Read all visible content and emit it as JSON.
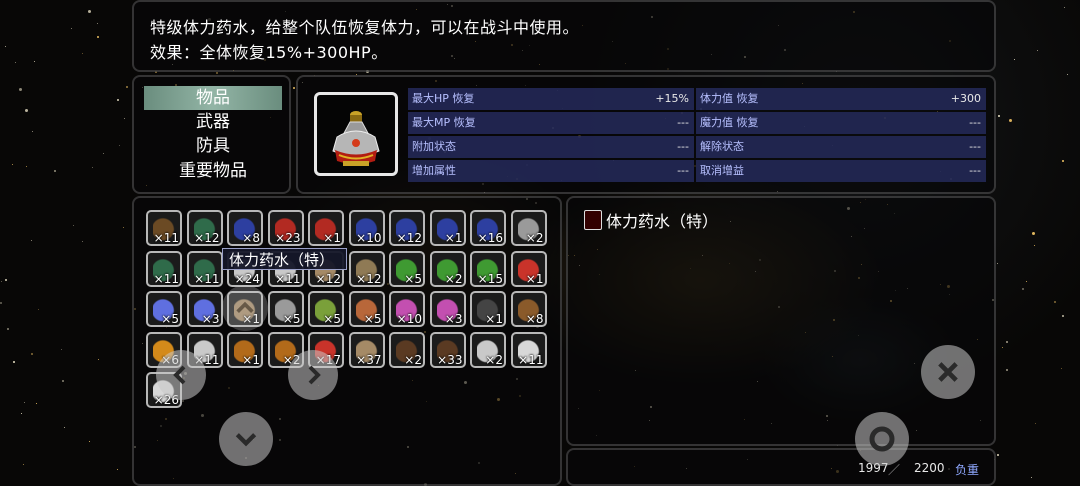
{
  "description": {
    "line1": "特级体力药水，给整个队伍恢复体力，可以在战斗中使用。",
    "line2": "效果：全体恢复15%+300HP。"
  },
  "categories": [
    {
      "label": "物品",
      "selected": true
    },
    {
      "label": "武器",
      "selected": false
    },
    {
      "label": "防具",
      "selected": false
    },
    {
      "label": "重要物品",
      "selected": false
    }
  ],
  "stats": [
    {
      "label": "最大HP 恢复",
      "value": "+15%"
    },
    {
      "label": "体力值 恢复",
      "value": "+300"
    },
    {
      "label": "最大MP 恢复",
      "value": "---"
    },
    {
      "label": "魔力值 恢复",
      "value": "---"
    },
    {
      "label": "附加状态",
      "value": "---"
    },
    {
      "label": "解除状态",
      "value": "---"
    },
    {
      "label": "增加属性",
      "value": "---"
    },
    {
      "label": "取消增益",
      "value": "---"
    }
  ],
  "items": [
    [
      "×11",
      "×12",
      "×8",
      "×23",
      "×1",
      "×10",
      "×12",
      "×1",
      "×16",
      "×2"
    ],
    [
      "×11",
      "×11",
      "×24",
      "×11",
      "×12",
      "×12",
      "×5",
      "×2",
      "×15",
      "×1"
    ],
    [
      "×5",
      "×3",
      "×1",
      "×5",
      "×5",
      "×5",
      "×10",
      "×3",
      "×1",
      "×8"
    ],
    [
      "×6",
      "×11",
      "×1",
      "×2",
      "×17",
      "×37",
      "×2",
      "×33",
      "×2",
      "×11"
    ],
    [
      "×26"
    ]
  ],
  "item_icons": [
    [
      "chest",
      "bottle",
      "flask",
      "potion",
      "potion",
      "flask",
      "flask",
      "flask",
      "flask",
      "jar"
    ],
    [
      "bottle",
      "bottle",
      "cloth",
      "cloth",
      "bone",
      "claw",
      "herb",
      "herb",
      "herb",
      "flower"
    ],
    [
      "crystal",
      "crystal",
      "bone",
      "jar",
      "fruit",
      "meat",
      "horn",
      "horn",
      "stone",
      "stick"
    ],
    [
      "torch",
      "cloth",
      "orb",
      "orb",
      "flower",
      "bone",
      "leather",
      "leather",
      "cloth",
      "scroll"
    ],
    [
      "scroll"
    ]
  ],
  "tooltip": "体力药水（特）",
  "detail": {
    "title": "体力药水（特）"
  },
  "weight": {
    "current": "1997",
    "separator": "／",
    "max": "2200",
    "label": "负重"
  },
  "colors": {
    "selected_category": "#8fb2a2",
    "stat_background": "#242a5a"
  }
}
